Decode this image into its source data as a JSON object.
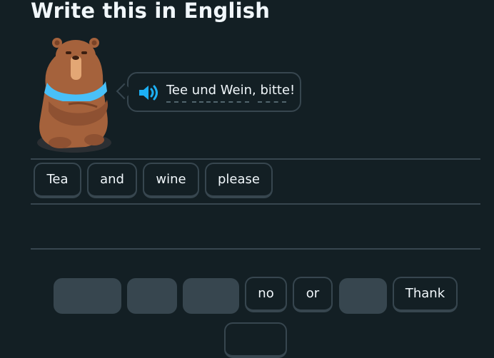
{
  "header": {
    "title": "Write this in English"
  },
  "prompt": {
    "text": "Tee und Wein, bitte!",
    "speaker_icon": "speaker-icon"
  },
  "answer_tiles": [
    {
      "label": "Tea"
    },
    {
      "label": "and"
    },
    {
      "label": "wine"
    },
    {
      "label": "please"
    }
  ],
  "word_bank": [
    {
      "label": "",
      "used": true
    },
    {
      "label": "",
      "used": true
    },
    {
      "label": "",
      "used": true
    },
    {
      "label": "no",
      "used": false
    },
    {
      "label": "or",
      "used": false
    },
    {
      "label": "",
      "used": true
    },
    {
      "label": "Thank",
      "used": false
    }
  ],
  "colors": {
    "background": "#131f24",
    "border": "#37464f",
    "text": "#f1f7fb",
    "accent_blue": "#1cb0f6",
    "bear_brown": "#a5623c",
    "bear_top": "#49c0f8"
  }
}
